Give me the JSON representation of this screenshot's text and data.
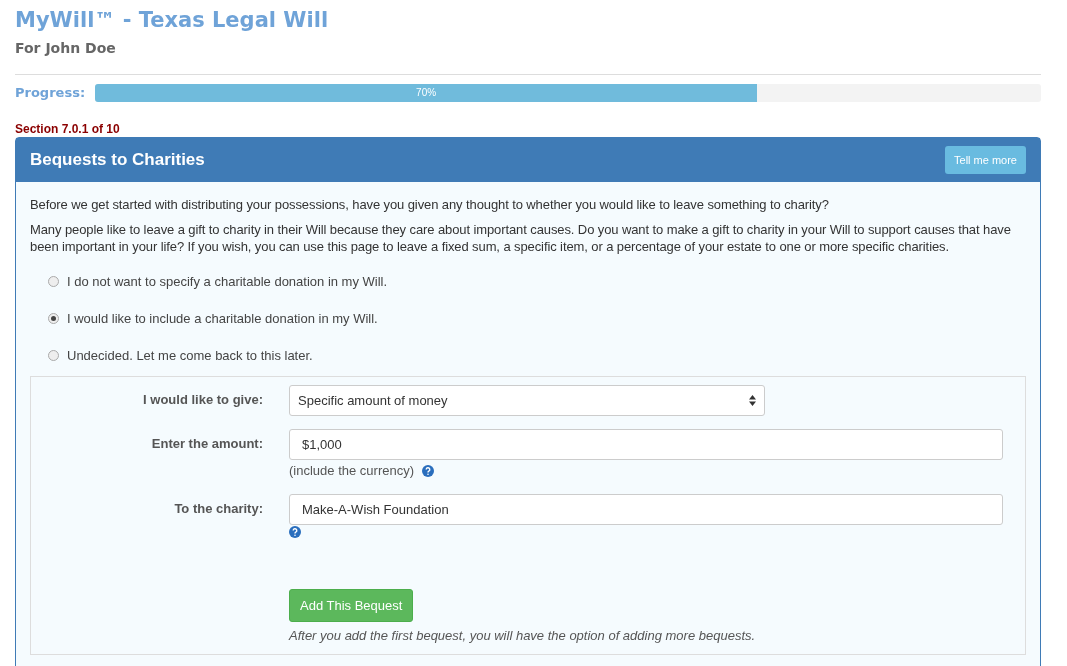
{
  "header": {
    "title": "MyWill™ - Texas Legal Will",
    "subtitle": "For John Doe"
  },
  "progress": {
    "label": "Progress:",
    "level": 0.7,
    "reading": "70%"
  },
  "section": "Section 7.0.1 of 10",
  "panel": {
    "title": "Bequests to Charities",
    "help_button": "Tell me more",
    "paragraphs": [
      "Before we get started with distributing your possessions, have you given any thought to whether you would like to leave something to charity?",
      "Many people like to leave a gift to charity in their Will because they care about important causes. Do you want to make a gift to charity in your Will to support causes that have been important in your life? If you wish, you can use this page to leave a fixed sum, a specific item, or a percentage of your estate to one or more specific charities."
    ],
    "options": [
      {
        "label": "I do not want to specify a charitable donation in my Will.",
        "selected": false
      },
      {
        "label": "I would like to include a charitable donation in my Will.",
        "selected": true
      },
      {
        "label": "Undecided. Let me come back to this later.",
        "selected": false
      }
    ],
    "form": {
      "fields": [
        {
          "kind": "select",
          "label": "I would like to give:",
          "value": "Specific amount of money"
        },
        {
          "kind": "text",
          "label": "Enter the amount:",
          "value": "$1,000",
          "hint": "(include the currency)",
          "help": true
        },
        {
          "kind": "text",
          "label": "To the charity:",
          "value": "Make-A-Wish Foundation",
          "help": true
        }
      ],
      "submit": "Add This Bequest",
      "note": "After you add the first bequest, you will have the option of adding more bequests."
    }
  }
}
